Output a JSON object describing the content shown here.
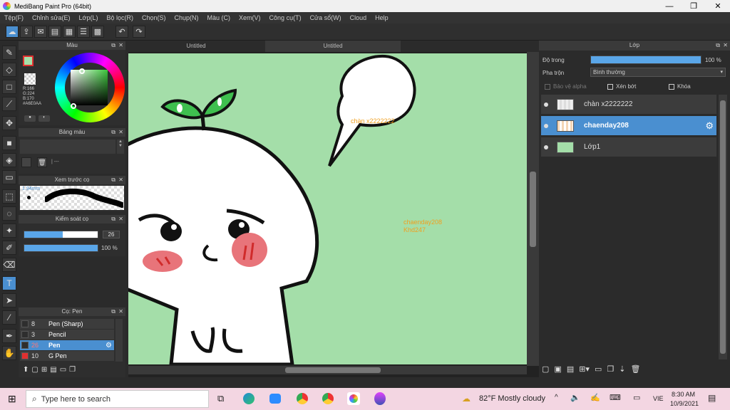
{
  "window": {
    "title": "MediBang Paint Pro (64bit)",
    "minimize": "—",
    "maximize": "❐",
    "close": "✕"
  },
  "menu": [
    "Tệp(F)",
    "Chỉnh sửa(E)",
    "Lớp(L)",
    "Bộ lọc(R)",
    "Chọn(S)",
    "Chụp(N)",
    "Màu (C)",
    "Xem(V)",
    "Công cụ(T)",
    "Cửa sổ(W)",
    "Cloud",
    "Help"
  ],
  "color_panel": {
    "title": "Màu",
    "r": "R:166",
    "g": "G:224",
    "b": "B:170",
    "hex": "#A6E0AA"
  },
  "palette_panel": {
    "title": "Bảng màu",
    "dashes": "| ---"
  },
  "preview_panel": {
    "title": "Xem trước cọ",
    "size": "1.94mm"
  },
  "control_panel": {
    "title": "Kiểm soát cọ",
    "size_value": "26",
    "opacity_value": "100 %",
    "size_fraction": 0.26,
    "opacity_fraction": 1.0
  },
  "brush_panel": {
    "title": "Cọ: Pen",
    "items": [
      {
        "size": "8",
        "name": "Pen (Sharp)",
        "selected": false,
        "color": "#2e2e2e"
      },
      {
        "size": "3",
        "name": "Pencil",
        "selected": false,
        "color": "#2e2e2e"
      },
      {
        "size": "26",
        "name": "Pen",
        "selected": true,
        "color": "#2e2e2e"
      },
      {
        "size": "10",
        "name": "G Pen",
        "selected": false,
        "color": "#e03030"
      }
    ]
  },
  "tabs": [
    "Untitled",
    "Untitled"
  ],
  "canvas_text": {
    "bubble": "chàn x2222222",
    "mid1": "chaenday208",
    "mid2": "Khd247"
  },
  "layer_panel": {
    "title": "Lớp",
    "opacity_label": "Độ trong",
    "opacity_value": "100 %",
    "blend_label": "Pha trộn",
    "blend_value": "Bình thường",
    "protect_alpha": "Bảo vệ alpha",
    "clip": "Xén bớt",
    "lock": "Khóa",
    "layers": [
      {
        "name": "chàn x2222222",
        "selected": false
      },
      {
        "name": "chaenday208",
        "selected": true
      },
      {
        "name": "Lớp1",
        "selected": false
      }
    ]
  },
  "taskbar": {
    "search_placeholder": "Type here to search",
    "weather": "82°F  Mostly cloudy",
    "lang": "VIE",
    "time": "8:30 AM",
    "date": "10/9/2021"
  },
  "colors": {
    "canvas_bg": "#a4dea9",
    "accent": "#4a8fd0",
    "taskbar": "#f3d6e2"
  }
}
